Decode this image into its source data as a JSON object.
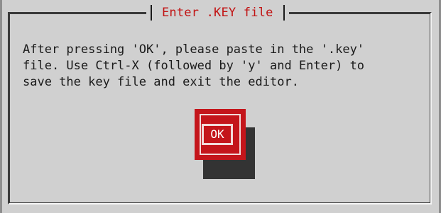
{
  "dialog": {
    "title": "Enter .KEY file",
    "message": "After pressing 'OK', please paste in the '.key'\nfile. Use Ctrl-X (followed by 'y' and Enter) to\nsave the key file and exit the editor.",
    "ok_label": "OK"
  },
  "colors": {
    "background": "#d0d0d0",
    "title_text": "#c11313",
    "button": "#c4151b",
    "button_text": "#ffffff",
    "button_shadow": "#333333"
  }
}
